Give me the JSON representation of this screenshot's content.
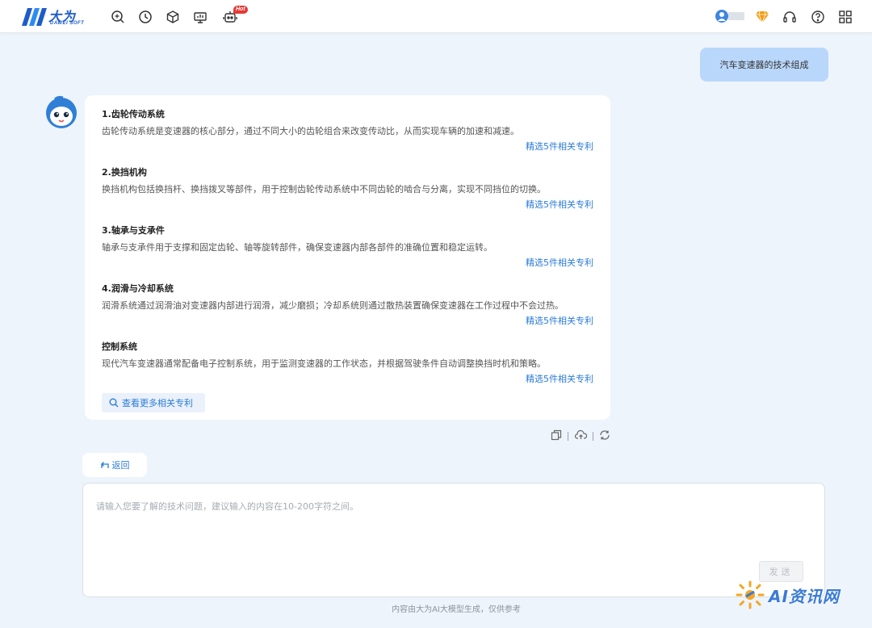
{
  "header": {
    "logo_text": "大为",
    "logo_sub": "DAWEI SOFT",
    "hot_badge": "Hot",
    "icons": [
      "search-chat-icon",
      "history-icon",
      "cube-icon",
      "monitor-chart-icon",
      "robot-icon",
      "user-avatar-icon",
      "diamond-icon",
      "headset-icon",
      "help-icon",
      "apps-grid-icon"
    ]
  },
  "conversation": {
    "user_question": "汽车变速器的技术组成",
    "sections": [
      {
        "title": "1.齿轮传动系统",
        "body": "齿轮传动系统是变速器的核心部分，通过不同大小的齿轮组合来改变传动比，从而实现车辆的加速和减速。",
        "link": "精选5件相关专利"
      },
      {
        "title": "2.换挡机构",
        "body": "换挡机构包括换挡杆、换挡拨叉等部件，用于控制齿轮传动系统中不同齿轮的啮合与分离，实现不同挡位的切换。",
        "link": "精选5件相关专利"
      },
      {
        "title": "3.轴承与支承件",
        "body": "轴承与支承件用于支撑和固定齿轮、轴等旋转部件，确保变速器内部各部件的准确位置和稳定运转。",
        "link": "精选5件相关专利"
      },
      {
        "title": "4.润滑与冷却系统",
        "body": "润滑系统通过润滑油对变速器内部进行润滑，减少磨损；冷却系统则通过散热装置确保变速器在工作过程中不会过热。",
        "link": "精选5件相关专利"
      },
      {
        "title": "控制系统",
        "body": "现代汽车变速器通常配备电子控制系统，用于监测变速器的工作状态，并根据驾驶条件自动调整换挡时机和策略。",
        "link": "精选5件相关专利"
      }
    ],
    "more_button": "查看更多相关专利",
    "action_icons": [
      "copy-icon",
      "cloud-save-icon",
      "regenerate-icon"
    ]
  },
  "back_button": "返回",
  "input": {
    "placeholder": "请输入您要了解的技术问题，建议输入的内容在10-200字符之间。",
    "value": "",
    "send_label": "发送"
  },
  "footer_note": "内容由大为AI大模型生成，仅供参考",
  "watermark": "AI资讯网",
  "colors": {
    "accent": "#2a7bd8",
    "user_bubble": "#b9d7fb",
    "page_bg": "#eef4fb",
    "hot": "#e53935",
    "diamond": "#f39c12"
  }
}
